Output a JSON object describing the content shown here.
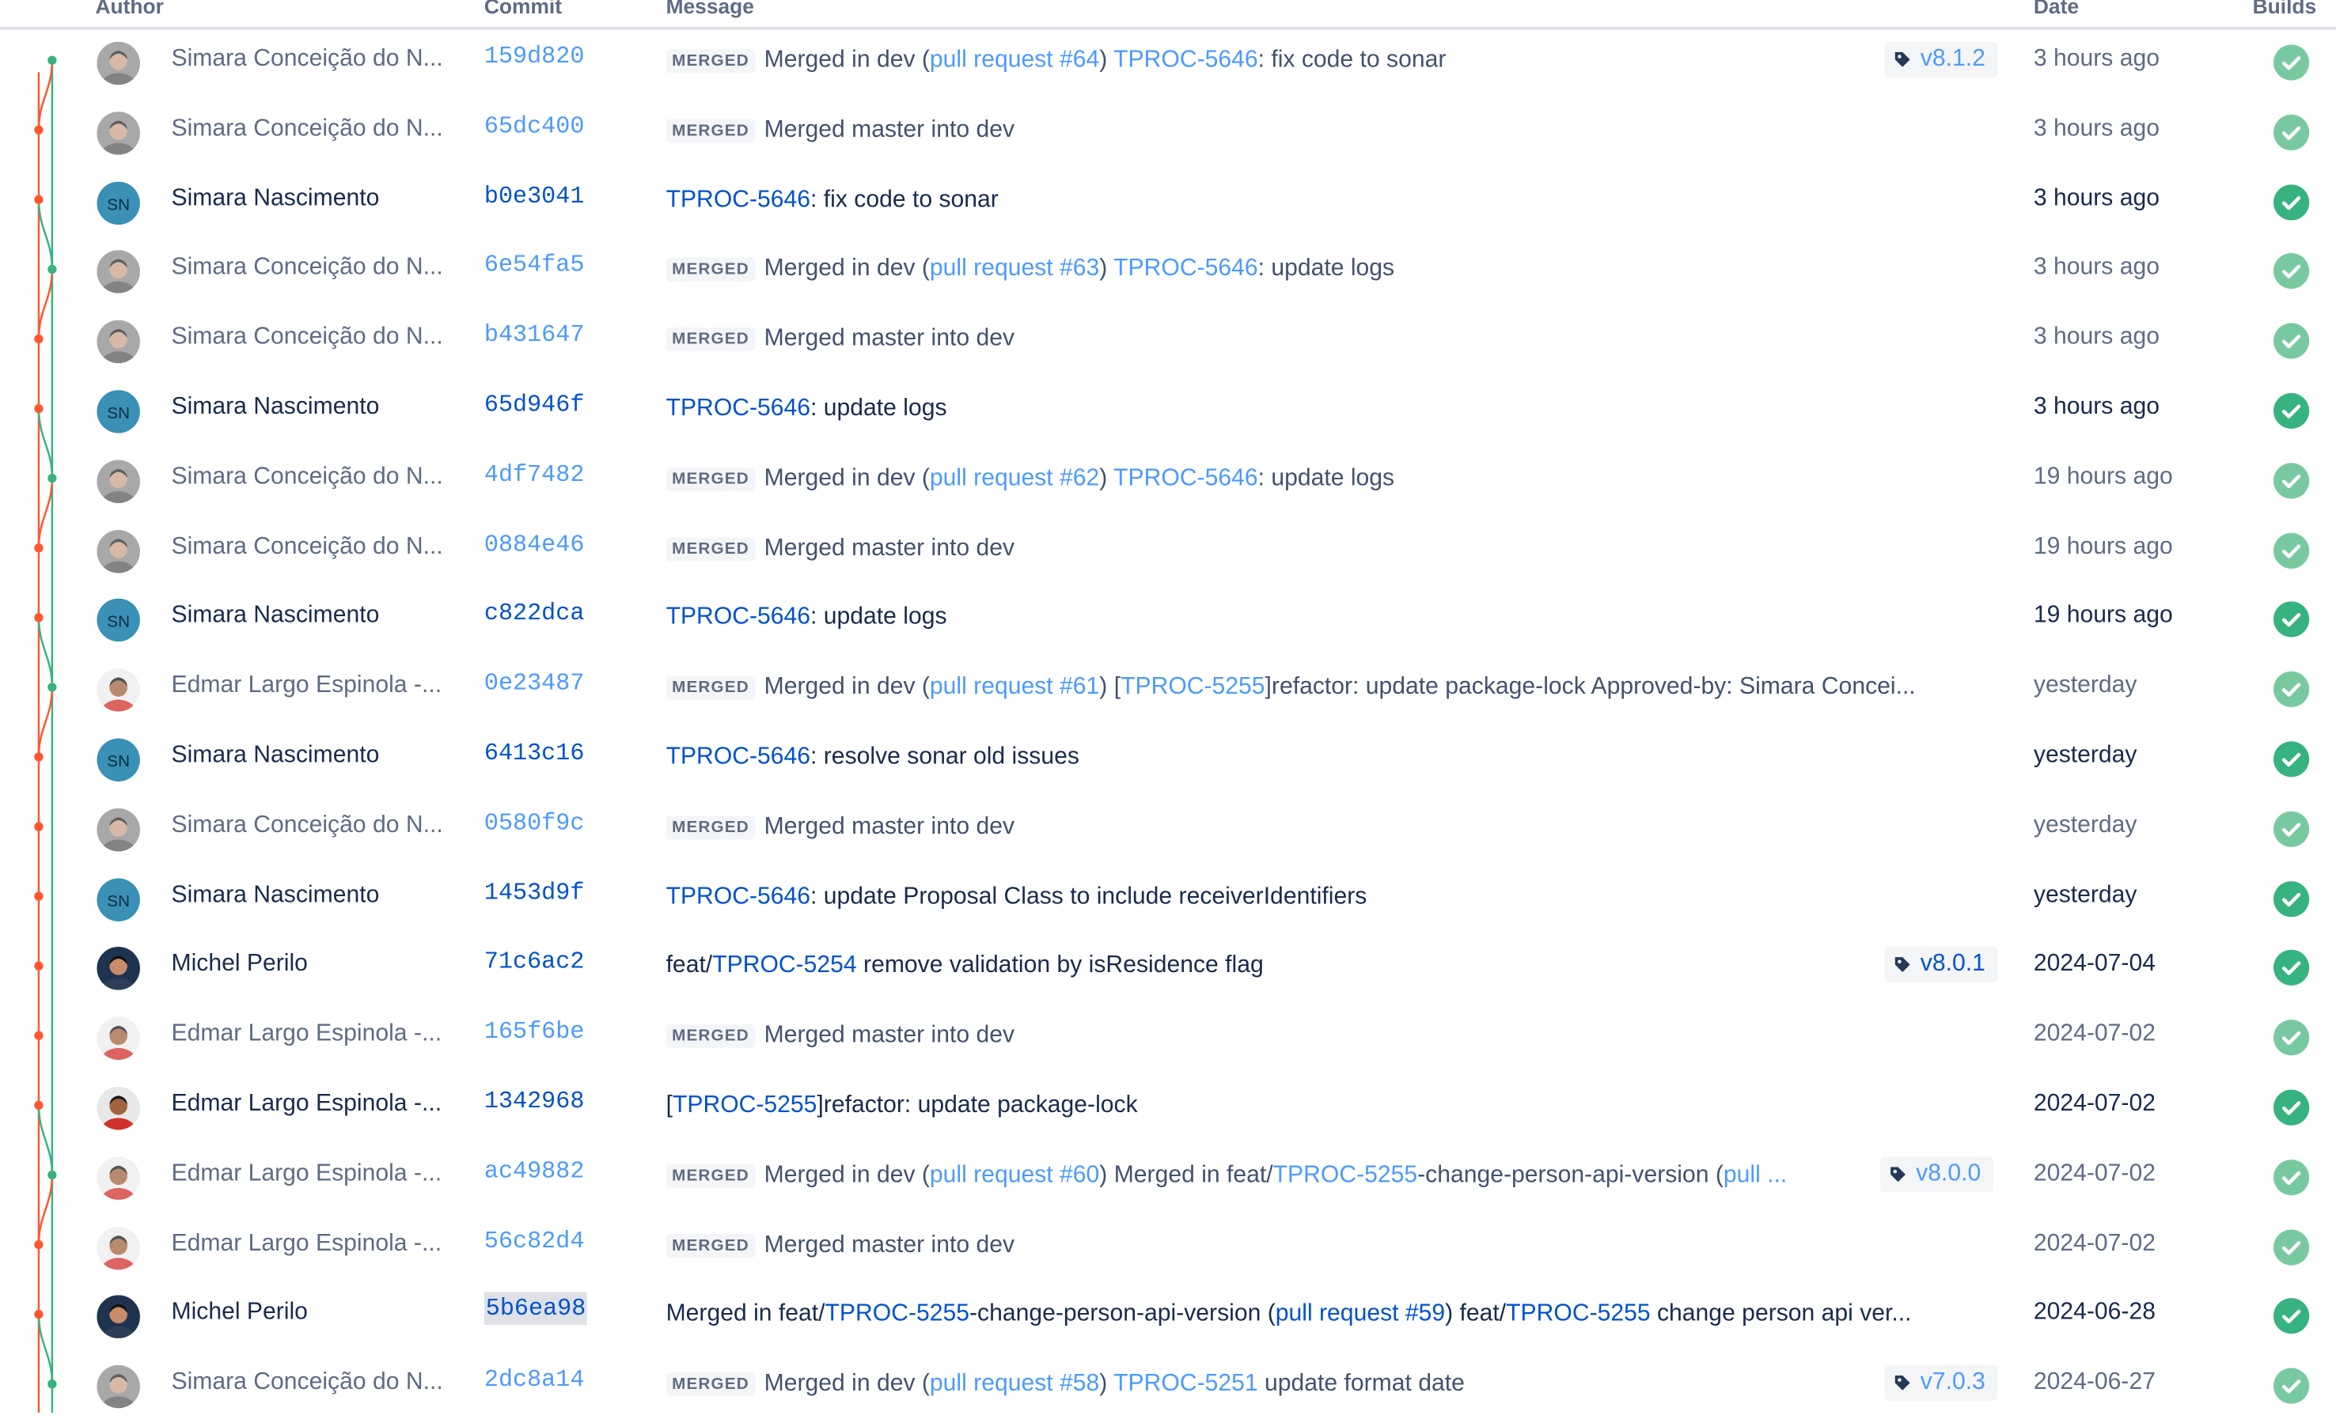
{
  "columns": {
    "author": "Author",
    "commit": "Commit",
    "message": "Message",
    "date": "Date",
    "builds": "Builds"
  },
  "colors": {
    "link": "#0052cc",
    "build_success": "#36b37e",
    "graph_master": "#36b37e",
    "graph_dev": "#ff5630"
  },
  "commits": [
    {
      "author": "Simara Conceição do N...",
      "hash": "159d820",
      "merged": true,
      "merged_label": "MERGED",
      "parts": [
        {
          "t": "Merged in dev ("
        },
        {
          "t": "pull request #64",
          "l": 1
        },
        {
          "t": ") "
        },
        {
          "t": "TPROC-5646",
          "l": 1
        },
        {
          "t": ": fix code to sonar",
          "d": 1
        }
      ],
      "tag": "v8.1.2",
      "date": "3 hours ago",
      "build": "success"
    },
    {
      "author": "Simara Conceição do N...",
      "hash": "65dc400",
      "merged": true,
      "merged_label": "MERGED",
      "parts": [
        {
          "t": "Merged master into dev"
        }
      ],
      "date": "3 hours ago",
      "build": "success"
    },
    {
      "author": "Simara Nascimento",
      "hash": "b0e3041",
      "merged": false,
      "initials": "SN",
      "parts": [
        {
          "t": "TPROC-5646",
          "l": 1
        },
        {
          "t": ": fix code to sonar"
        }
      ],
      "date": "3 hours ago",
      "build": "success"
    },
    {
      "author": "Simara Conceição do N...",
      "hash": "6e54fa5",
      "merged": true,
      "merged_label": "MERGED",
      "parts": [
        {
          "t": "Merged in dev ("
        },
        {
          "t": "pull request #63",
          "l": 1
        },
        {
          "t": ") "
        },
        {
          "t": "TPROC-5646",
          "l": 1
        },
        {
          "t": ": update logs",
          "d": 1
        }
      ],
      "date": "3 hours ago",
      "build": "success"
    },
    {
      "author": "Simara Conceição do N...",
      "hash": "b431647",
      "merged": true,
      "merged_label": "MERGED",
      "parts": [
        {
          "t": "Merged master into dev"
        }
      ],
      "date": "3 hours ago",
      "build": "success"
    },
    {
      "author": "Simara Nascimento",
      "hash": "65d946f",
      "merged": false,
      "initials": "SN",
      "parts": [
        {
          "t": "TPROC-5646",
          "l": 1
        },
        {
          "t": ": update logs"
        }
      ],
      "date": "3 hours ago",
      "build": "success"
    },
    {
      "author": "Simara Conceição do N...",
      "hash": "4df7482",
      "merged": true,
      "merged_label": "MERGED",
      "parts": [
        {
          "t": "Merged in dev ("
        },
        {
          "t": "pull request #62",
          "l": 1
        },
        {
          "t": ") "
        },
        {
          "t": "TPROC-5646",
          "l": 1
        },
        {
          "t": ": update logs",
          "d": 1
        }
      ],
      "date": "19 hours ago",
      "build": "success"
    },
    {
      "author": "Simara Conceição do N...",
      "hash": "0884e46",
      "merged": true,
      "merged_label": "MERGED",
      "parts": [
        {
          "t": "Merged master into dev"
        }
      ],
      "date": "19 hours ago",
      "build": "success"
    },
    {
      "author": "Simara Nascimento",
      "hash": "c822dca",
      "merged": false,
      "initials": "SN",
      "parts": [
        {
          "t": "TPROC-5646",
          "l": 1
        },
        {
          "t": ": update logs"
        }
      ],
      "date": "19 hours ago",
      "build": "success"
    },
    {
      "author": "Edmar Largo Espinola -...",
      "hash": "0e23487",
      "merged": true,
      "merged_label": "MERGED",
      "parts": [
        {
          "t": "Merged in dev ("
        },
        {
          "t": "pull request #61",
          "l": 1
        },
        {
          "t": ") "
        },
        {
          "t": "[",
          "d": 1
        },
        {
          "t": "TPROC-5255",
          "l": 1
        },
        {
          "t": "]refactor: update package-lock Approved-by: Simara Concei...",
          "d": 1
        }
      ],
      "date": "yesterday",
      "build": "success"
    },
    {
      "author": "Simara Nascimento",
      "hash": "6413c16",
      "merged": false,
      "initials": "SN",
      "parts": [
        {
          "t": "TPROC-5646",
          "l": 1
        },
        {
          "t": ": resolve sonar old issues"
        }
      ],
      "date": "yesterday",
      "build": "success"
    },
    {
      "author": "Simara Conceição do N...",
      "hash": "0580f9c",
      "merged": true,
      "merged_label": "MERGED",
      "parts": [
        {
          "t": "Merged master into dev"
        }
      ],
      "date": "yesterday",
      "build": "success"
    },
    {
      "author": "Simara Nascimento",
      "hash": "1453d9f",
      "merged": false,
      "initials": "SN",
      "parts": [
        {
          "t": "TPROC-5646",
          "l": 1
        },
        {
          "t": ": update Proposal Class to include receiverIdentifiers"
        }
      ],
      "date": "yesterday",
      "build": "success"
    },
    {
      "author": "Michel Perilo",
      "hash": "71c6ac2",
      "merged": false,
      "parts": [
        {
          "t": "feat/"
        },
        {
          "t": "TPROC-5254",
          "l": 1
        },
        {
          "t": " remove validation by isResidence flag"
        }
      ],
      "tag": "v8.0.1",
      "date": "2024-07-04",
      "build": "success"
    },
    {
      "author": "Edmar Largo Espinola -...",
      "hash": "165f6be",
      "merged": true,
      "merged_label": "MERGED",
      "parts": [
        {
          "t": "Merged master into dev"
        }
      ],
      "date": "2024-07-02",
      "build": "success"
    },
    {
      "author": "Edmar Largo Espinola -...",
      "hash": "1342968",
      "merged": false,
      "parts": [
        {
          "t": "["
        },
        {
          "t": "TPROC-5255",
          "l": 1
        },
        {
          "t": "]refactor: update package-lock"
        }
      ],
      "date": "2024-07-02",
      "build": "success"
    },
    {
      "author": "Edmar Largo Espinola -...",
      "hash": "ac49882",
      "merged": true,
      "merged_label": "MERGED",
      "parts": [
        {
          "t": "Merged in dev ("
        },
        {
          "t": "pull request #60",
          "l": 1
        },
        {
          "t": ") "
        },
        {
          "t": "Merged in feat/",
          "d": 1
        },
        {
          "t": "TPROC-5255",
          "l": 1
        },
        {
          "t": "-change-person-api-version (",
          "d": 1
        },
        {
          "t": "pull ...",
          "l": 1
        }
      ],
      "tag": "v8.0.0",
      "date": "2024-07-02",
      "build": "success"
    },
    {
      "author": "Edmar Largo Espinola -...",
      "hash": "56c82d4",
      "merged": true,
      "merged_label": "MERGED",
      "parts": [
        {
          "t": "Merged master into dev"
        }
      ],
      "date": "2024-07-02",
      "build": "success"
    },
    {
      "author": "Michel Perilo",
      "hash": "5b6ea98",
      "merged": false,
      "highlight": true,
      "parts": [
        {
          "t": "Merged in feat/"
        },
        {
          "t": "TPROC-5255",
          "l": 1
        },
        {
          "t": "-change-person-api-version ("
        },
        {
          "t": "pull request #59",
          "l": 1
        },
        {
          "t": ") feat/"
        },
        {
          "t": "TPROC-5255",
          "l": 1
        },
        {
          "t": " change person api ver..."
        }
      ],
      "date": "2024-06-28",
      "build": "success"
    },
    {
      "author": "Simara Conceição do N...",
      "hash": "2dc8a14",
      "merged": true,
      "merged_label": "MERGED",
      "parts": [
        {
          "t": "Merged in dev ("
        },
        {
          "t": "pull request #58",
          "l": 1
        },
        {
          "t": ") "
        },
        {
          "t": "TPROC-5251",
          "l": 1
        },
        {
          "t": " update format date",
          "d": 1
        }
      ],
      "tag": "v7.0.3",
      "date": "2024-06-27",
      "build": "success"
    }
  ]
}
